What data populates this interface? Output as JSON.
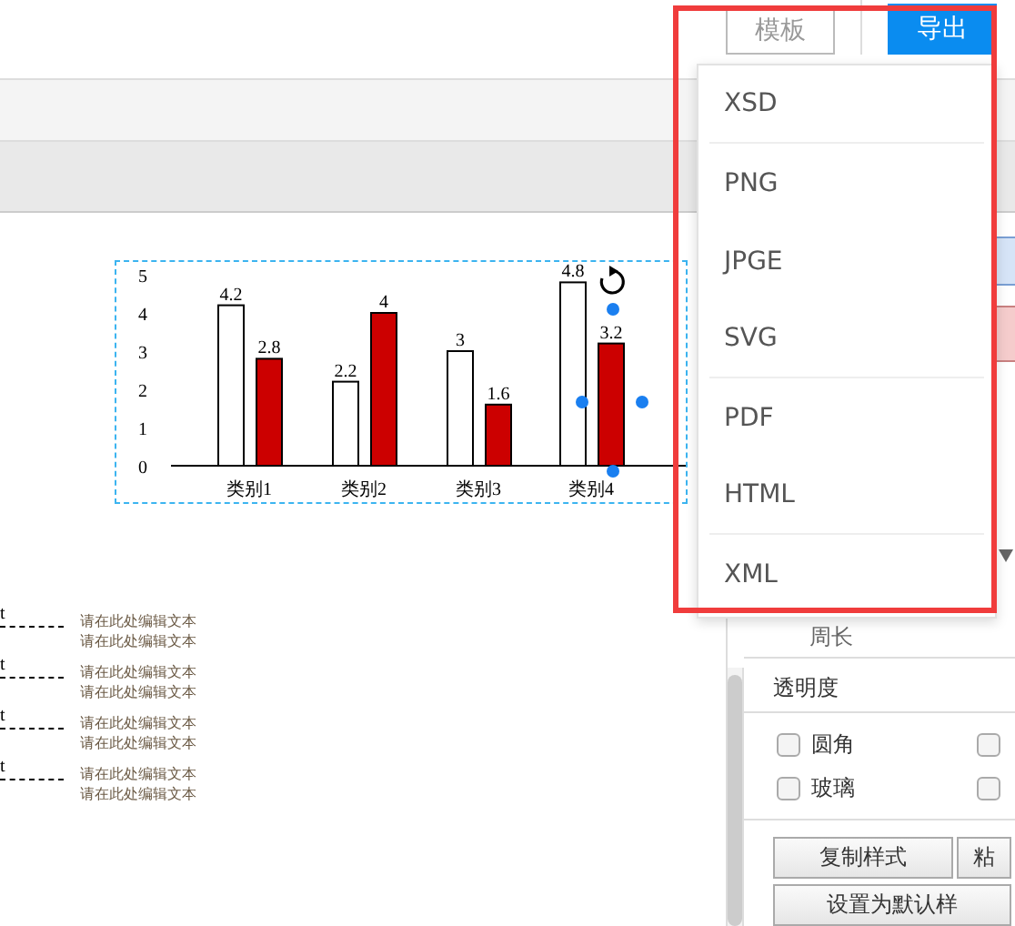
{
  "toolbar": {
    "buttons": [
      {
        "label": "模板",
        "kind": "outline"
      },
      {
        "label": "导出",
        "kind": "primary"
      }
    ]
  },
  "chart": {
    "chart_data": {
      "type": "bar",
      "categories": [
        "类别1",
        "类别2",
        "类别3",
        "类别4"
      ],
      "ylim": [
        0,
        5
      ],
      "yticks": [
        0,
        1,
        2,
        3,
        4,
        5
      ],
      "data_labels": true,
      "series": [
        {
          "color": "#ffffff",
          "values": [
            4.2,
            2.2,
            3,
            4.8
          ]
        },
        {
          "color": "#cc0000",
          "values": [
            2.8,
            4,
            1.6,
            3.2
          ]
        }
      ]
    }
  },
  "callouts": [
    {
      "mark": "t",
      "lines": [
        "请在此处编辑文本",
        "请在此处编辑文本"
      ]
    },
    {
      "mark": "t",
      "lines": [
        "请在此处编辑文本",
        "请在此处编辑文本"
      ]
    },
    {
      "mark": "t",
      "lines": [
        "请在此处编辑文本",
        "请在此处编辑文本"
      ]
    },
    {
      "mark": "t",
      "lines": [
        "请在此处编辑文本",
        "请在此处编辑文本"
      ]
    }
  ],
  "export_menu": {
    "items": [
      {
        "label": "XSD",
        "divider_after": true
      },
      {
        "label": "PNG",
        "divider_after": false
      },
      {
        "label": "JPGE",
        "divider_after": false
      },
      {
        "label": "SVG",
        "divider_after": true
      },
      {
        "label": "PDF",
        "divider_after": false
      },
      {
        "label": "HTML",
        "divider_after": true
      },
      {
        "label": "XML",
        "divider_after": false
      }
    ]
  },
  "style_panel": {
    "swatches": [
      {
        "color": "#d6e4f7"
      },
      {
        "color": "#f5cccc"
      }
    ],
    "field": "周长",
    "section": "透明度",
    "options": [
      {
        "label": "圆角",
        "checked": false
      },
      {
        "checked": false
      },
      {
        "label": "玻璃",
        "checked": false
      },
      {
        "checked": false
      }
    ],
    "buttons": [
      "复制样式",
      "粘",
      "设置为默认样"
    ]
  }
}
